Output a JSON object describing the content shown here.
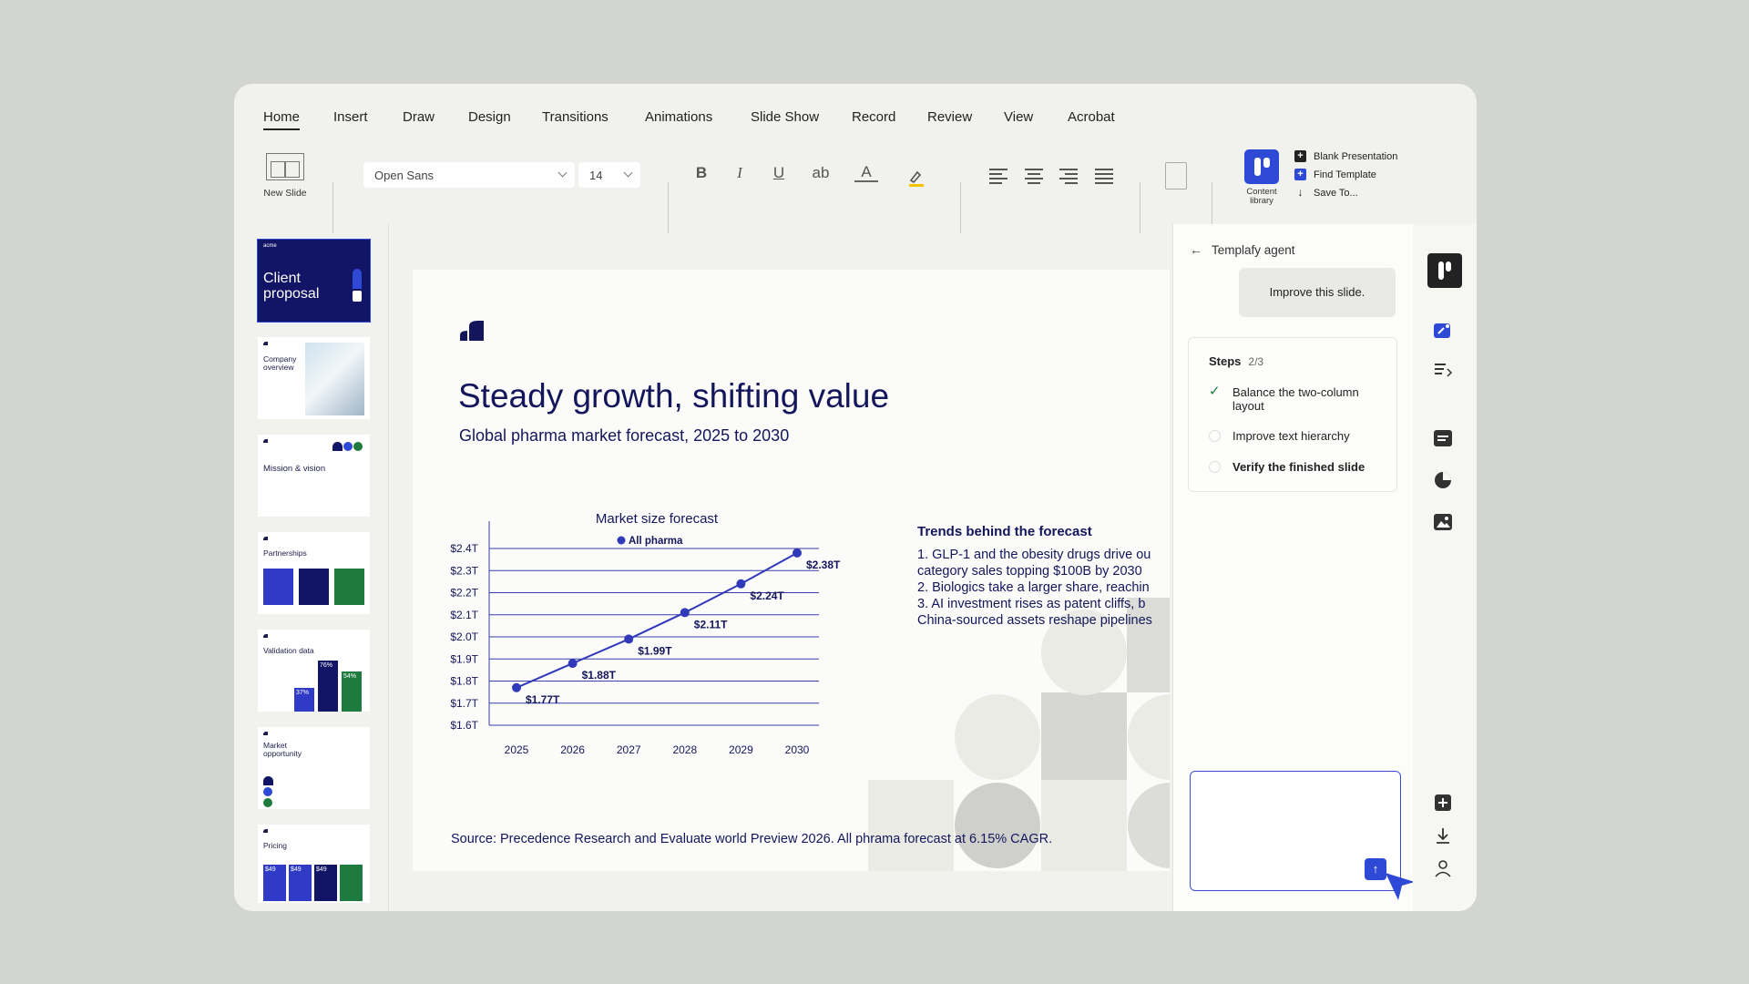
{
  "ribbon": {
    "tabs": [
      "Home",
      "Insert",
      "Draw",
      "Design",
      "Transitions",
      "Animations",
      "Slide Show",
      "Record",
      "Review",
      "View",
      "Acrobat"
    ],
    "new_slide": "New Slide",
    "font": "Open Sans",
    "font_size": "14",
    "bold": "B",
    "italic": "I",
    "underline": "U",
    "strike": "ab",
    "font_color": "A",
    "content_library": "Content library",
    "quick_actions": [
      "Blank Presentation",
      "Find Template",
      "Save To..."
    ]
  },
  "thumbnails": {
    "t1_brand": "acme",
    "t1_title": "Client proposal",
    "t2_title": "Company overview",
    "t3_title": "Mission & vision",
    "t4_title": "Partnerships",
    "t5_title": "Validation data",
    "t5_v1": "37%",
    "t5_v2": "76%",
    "t5_v3": "54%",
    "t6_title": "Market opportunity",
    "t7_title": "Pricing",
    "t7_price": "$49"
  },
  "slide": {
    "title": "Steady growth, shifting value",
    "subtitle": "Global pharma market forecast, 2025 to 2030",
    "trends_title": "Trends behind the forecast",
    "trends": [
      "1.    GLP-1 and the obesity drugs drive ou",
      "  category sales topping $100B by 2030",
      "2.    Biologics take a larger share, reachin",
      "3.    AI investment rises as patent cliffs, b",
      "  China-sourced assets reshape pipelines"
    ],
    "source": "Source: Precedence Research and Evaluate world Preview 2026. All phrama forecast at 6.15% CAGR."
  },
  "chart_data": {
    "type": "line",
    "title": "Market size forecast",
    "x": [
      2025,
      2026,
      2027,
      2028,
      2029,
      2030
    ],
    "series": [
      {
        "name": "All pharma",
        "values": [
          1.77,
          1.88,
          1.99,
          2.11,
          2.24,
          2.38
        ]
      }
    ],
    "data_labels": [
      "$1.77T",
      "$1.88T",
      "$1.99T",
      "$2.11T",
      "$2.24T",
      "$2.38T"
    ],
    "y_ticks": [
      "$1.6T",
      "$1.7T",
      "$1.8T",
      "$1.9T",
      "$2.0T",
      "$2.1T",
      "$2.2T",
      "$2.3T",
      "$2.4T"
    ],
    "ylim": [
      1.6,
      2.4
    ],
    "grid": true,
    "legend": "top-center",
    "color": "#3039b8"
  },
  "agent": {
    "title": "Templafy agent",
    "user_message": "Improve this slide.",
    "steps_label": "Steps",
    "steps_count": "2/3",
    "steps": [
      {
        "text": "Balance the two-column layout",
        "done": true
      },
      {
        "text": "Improve text hierarchy",
        "done": false
      },
      {
        "text": "Verify the finished slide",
        "done": false
      }
    ],
    "input_placeholder": ""
  },
  "colors": {
    "accent": "#2f49d7",
    "navy": "#14165c",
    "green": "#1e7a3e"
  }
}
